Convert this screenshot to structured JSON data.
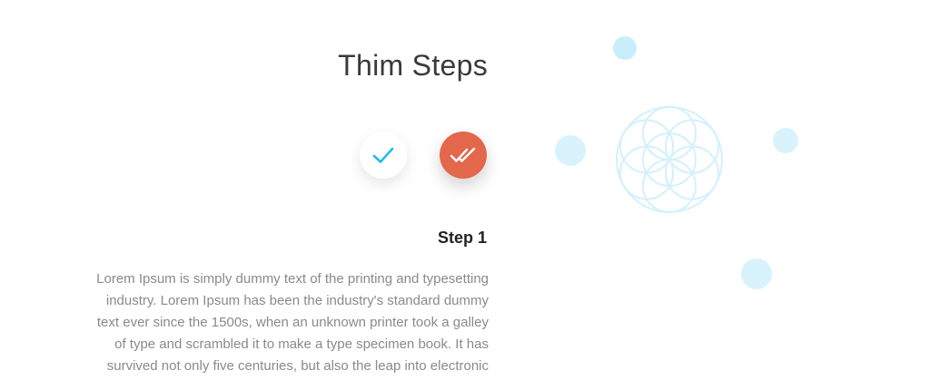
{
  "section": {
    "title": "Thim Steps"
  },
  "steps": [
    {
      "icon": "check-icon",
      "state": "inactive"
    },
    {
      "icon": "double-check-icon",
      "state": "active"
    }
  ],
  "step_content": {
    "heading": "Step 1",
    "lines": [
      "Lorem Ipsum is simply dummy text of the printing and typesetting",
      "industry. Lorem Ipsum has been the industry's standard dummy",
      "text ever since the 1500s, when an unknown printer took a galley",
      "of type and scrambled it to make a type specimen book. It has",
      "survived not only five centuries, but also the leap into electronic"
    ]
  },
  "colors": {
    "accent_blue": "#2bb7ee",
    "accent_orange": "#e2674b",
    "deco_light_blue": "#d8f3fc"
  }
}
